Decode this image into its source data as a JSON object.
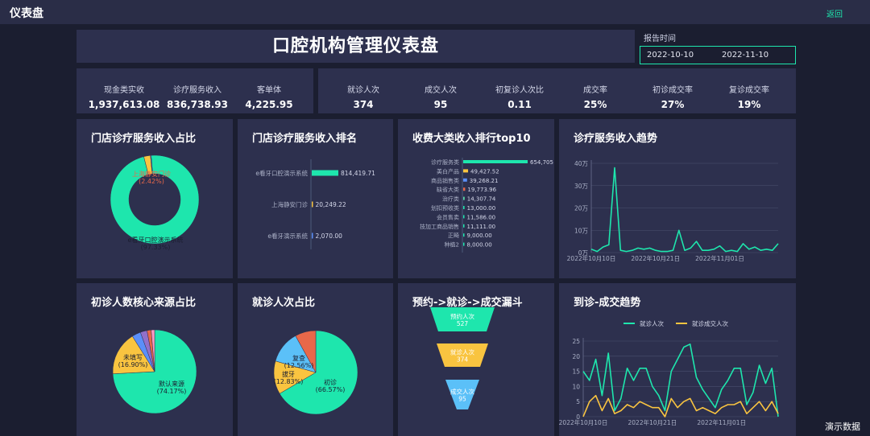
{
  "app": {
    "title": "仪表盘",
    "back": "返回",
    "demo": "演示数据"
  },
  "header": {
    "title": "口腔机构管理仪表盘",
    "report_label": "报告时间",
    "date_start": "2022-10-10",
    "date_end": "2022-11-10"
  },
  "kpis_left": [
    {
      "label": "现金类实收",
      "value": "1,937,613.08"
    },
    {
      "label": "诊疗服务收入",
      "value": "836,738.93"
    },
    {
      "label": "客单体",
      "value": "4,225.95"
    }
  ],
  "kpis_right": [
    {
      "label": "就诊人次",
      "value": "374"
    },
    {
      "label": "成交人次",
      "value": "95"
    },
    {
      "label": "初复诊人次比",
      "value": "0.11"
    },
    {
      "label": "成交率",
      "value": "25%"
    },
    {
      "label": "初诊成交率",
      "value": "27%"
    },
    {
      "label": "复诊成交率",
      "value": "19%"
    }
  ],
  "cards": {
    "c1": "门店诊疗服务收入占比",
    "c2": "门店诊疗服务收入排名",
    "c3": "收费大类收入排行top10",
    "c4": "诊疗服务收入趋势",
    "c5": "初诊人数核心来源占比",
    "c6": "就诊人次占比",
    "c7": "预约->就诊->成交漏斗",
    "c8": "到诊-成交趋势"
  },
  "chart_data": [
    {
      "type": "pie",
      "id": "store-share",
      "variant": "donut",
      "slices": [
        {
          "label": "e看牙口腔演示系统",
          "pct_text": "(97.33%)",
          "value": 97.33,
          "color": "#1ee6ad"
        },
        {
          "label": "上海静安门诊",
          "pct_text": "(2.42%)",
          "value": 2.42,
          "color": "#f9c440"
        },
        {
          "label": "",
          "pct_text": "",
          "value": 0.25,
          "color": "#5b8ff9"
        }
      ]
    },
    {
      "type": "bar",
      "id": "store-rank",
      "orientation": "horizontal",
      "categories": [
        "e看牙口腔演示系统",
        "上海静安门诊",
        "e看牙演示系统"
      ],
      "values": [
        814419.71,
        20249.22,
        2070.0
      ],
      "value_labels": [
        "814,419.71",
        "20,249.22",
        "2,070.00"
      ],
      "colors": [
        "#1ee6ad",
        "#f9c440",
        "#5b8ff9"
      ]
    },
    {
      "type": "bar",
      "id": "fee-top10",
      "orientation": "horizontal",
      "categories": [
        "诊疗服务类",
        "美白产品",
        "商品销售类",
        "缺省大类",
        "治疗类",
        "划扣预收类",
        "会员售卖",
        "技加工商品销售",
        "正畸",
        "种植2"
      ],
      "values": [
        654705,
        49427.52,
        39268.21,
        19773.96,
        14307.74,
        13000.0,
        11586.0,
        11111.0,
        9000.0,
        8000.0
      ],
      "value_labels": [
        "654,705",
        "49,427.52",
        "39,268.21",
        "19,773.96",
        "14,307.74",
        "13,000.00",
        "11,586.00",
        "11,111.00",
        "9,000.00",
        "8,000.00"
      ],
      "colors": [
        "#1ee6ad",
        "#f9c440",
        "#5b8ff9",
        "#e8684a",
        "#5ad8a6",
        "#1ee6ad",
        "#1ee6ad",
        "#1ee6ad",
        "#1ee6ad",
        "#1ee6ad"
      ]
    },
    {
      "type": "line",
      "id": "service-trend",
      "x_ticks": [
        "2022年10月10日",
        "2022年10月21日",
        "2022年11月01日"
      ],
      "x_tick_index": [
        0,
        11,
        22
      ],
      "y_ticks": [
        "0万",
        "10万",
        "20万",
        "30万",
        "40万"
      ],
      "ylim": [
        0,
        40
      ],
      "values": [
        1.5,
        0.5,
        2.5,
        3.5,
        38,
        1,
        0.5,
        1,
        2,
        1.5,
        2,
        1,
        0.5,
        0.5,
        1,
        10,
        1,
        2,
        5,
        1,
        1,
        1.5,
        3,
        0.5,
        1,
        0.5,
        4,
        1.5,
        2.5,
        1,
        1.5,
        1,
        4
      ],
      "color": "#1ee6ad"
    },
    {
      "type": "pie",
      "id": "first-visit-source",
      "slices": [
        {
          "label": "默认来源",
          "pct_text": "(74.17%)",
          "value": 74.17,
          "color": "#1ee6ad"
        },
        {
          "label": "未填写",
          "pct_text": "(16.90%)",
          "value": 16.9,
          "color": "#f9c440"
        },
        {
          "label": "",
          "pct_text": "",
          "value": 3.4,
          "color": "#5b8ff9"
        },
        {
          "label": "",
          "pct_text": "",
          "value": 2.6,
          "color": "#9270ca"
        },
        {
          "label": "",
          "pct_text": "",
          "value": 1.6,
          "color": "#e8684a"
        },
        {
          "label": "",
          "pct_text": "",
          "value": 1.33,
          "color": "#ff99c3"
        }
      ]
    },
    {
      "type": "pie",
      "id": "visit-share",
      "slices": [
        {
          "label": "初诊",
          "pct_text": "(66.57%)",
          "value": 66.57,
          "color": "#1ee6ad"
        },
        {
          "label": "拔牙",
          "pct_text": "(12.83%)",
          "value": 12.83,
          "color": "#f9c440"
        },
        {
          "label": "复查",
          "pct_text": "(12.56%)",
          "value": 12.56,
          "color": "#5bc0f8"
        },
        {
          "label": "",
          "pct_text": "",
          "value": 8.04,
          "color": "#e8684a"
        }
      ]
    },
    {
      "type": "funnel",
      "id": "conversion-funnel",
      "stages": [
        {
          "label": "预约人次",
          "value": 527,
          "color": "#1ee6ad"
        },
        {
          "label": "就诊人次",
          "value": 374,
          "color": "#f9c440"
        },
        {
          "label": "成交人次",
          "value": 95,
          "color": "#5bc0f8"
        }
      ]
    },
    {
      "type": "line",
      "id": "visit-deal-trend",
      "legend": [
        "就诊人次",
        "就诊成交人次"
      ],
      "colors": [
        "#1ee6ad",
        "#f9c440"
      ],
      "x_ticks": [
        "2022年10月10日",
        "2022年10月21日",
        "2022年11月01日"
      ],
      "x_tick_index": [
        0,
        11,
        22
      ],
      "y_ticks": [
        "0",
        "5",
        "10",
        "15",
        "20",
        "25"
      ],
      "ylim": [
        0,
        25
      ],
      "series": [
        {
          "name": "就诊人次",
          "values": [
            15,
            12,
            19,
            7,
            21,
            2,
            6,
            16,
            12,
            16,
            16,
            10,
            7,
            2,
            15,
            19,
            23,
            24,
            13,
            9,
            6,
            3,
            9,
            12,
            16,
            16,
            4,
            8,
            17,
            11,
            16,
            0
          ]
        },
        {
          "name": "就诊成交人次",
          "values": [
            0,
            5,
            7,
            2,
            6,
            1,
            2,
            4,
            3,
            5,
            4,
            3,
            3,
            0,
            6,
            3,
            5,
            6,
            2,
            3,
            2,
            1,
            3,
            4,
            4,
            5,
            1,
            3,
            5,
            2,
            5,
            1
          ]
        }
      ]
    }
  ]
}
